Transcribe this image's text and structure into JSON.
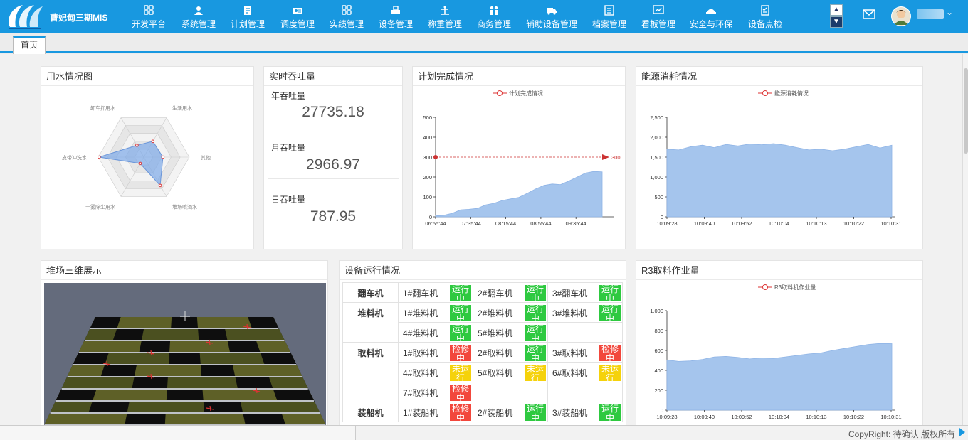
{
  "app": {
    "title": "曹妃甸三期MIS"
  },
  "nav": [
    {
      "label": "开发平台",
      "icon": "grid-icon"
    },
    {
      "label": "系统管理",
      "icon": "user-gear-icon"
    },
    {
      "label": "计划管理",
      "icon": "document-icon"
    },
    {
      "label": "调度管理",
      "icon": "dispatch-icon"
    },
    {
      "label": "实绩管理",
      "icon": "grid-icon"
    },
    {
      "label": "设备管理",
      "icon": "equipment-icon"
    },
    {
      "label": "称重管理",
      "icon": "scale-icon"
    },
    {
      "label": "商务管理",
      "icon": "people-icon"
    },
    {
      "label": "辅助设备管理",
      "icon": "truck-icon"
    },
    {
      "label": "档案管理",
      "icon": "archive-icon"
    },
    {
      "label": "看板管理",
      "icon": "board-icon"
    },
    {
      "label": "安全与环保",
      "icon": "safety-icon"
    },
    {
      "label": "设备点检",
      "icon": "checklist-icon"
    }
  ],
  "header_controls": {
    "up": "▲",
    "down": "▼",
    "caret": "⌄"
  },
  "tabs": [
    {
      "label": "首页",
      "active": true
    }
  ],
  "panels": {
    "water": {
      "title": "用水情况图"
    },
    "throughput": {
      "title": "实时吞吐量",
      "items": [
        {
          "label": "年吞吐量",
          "value": "27735.18"
        },
        {
          "label": "月吞吐量",
          "value": "2966.97"
        },
        {
          "label": "日吞吐量",
          "value": "787.95"
        }
      ]
    },
    "plan": {
      "title": "计划完成情况"
    },
    "energy": {
      "title": "能源消耗情况"
    },
    "yard3d": {
      "title": "堆场三维展示"
    },
    "equipment": {
      "title": "设备运行情况"
    },
    "r3": {
      "title": "R3取料作业量"
    }
  },
  "status_colors": {
    "运行中": "#2ec940",
    "检修中": "#f2473c",
    "未运行": "#f5d20b"
  },
  "equipment_groups": [
    {
      "name": "翻车机",
      "rows": [
        [
          {
            "name": "1#翻车机",
            "status": "运行中"
          },
          {
            "name": "2#翻车机",
            "status": "运行中"
          },
          {
            "name": "3#翻车机",
            "status": "运行中"
          }
        ]
      ]
    },
    {
      "name": "堆料机",
      "rows": [
        [
          {
            "name": "1#堆料机",
            "status": "运行中"
          },
          {
            "name": "2#堆料机",
            "status": "运行中"
          },
          {
            "name": "3#堆料机",
            "status": "运行中"
          }
        ],
        [
          {
            "name": "4#堆料机",
            "status": "运行中"
          },
          {
            "name": "5#堆料机",
            "status": "运行中"
          },
          null
        ]
      ]
    },
    {
      "name": "取料机",
      "rows": [
        [
          {
            "name": "1#取料机",
            "status": "检修中"
          },
          {
            "name": "2#取料机",
            "status": "运行中"
          },
          {
            "name": "3#取料机",
            "status": "检修中"
          }
        ],
        [
          {
            "name": "4#取料机",
            "status": "未运行"
          },
          {
            "name": "5#取料机",
            "status": "未运行"
          },
          {
            "name": "6#取料机",
            "status": "未运行"
          }
        ],
        [
          {
            "name": "7#取料机",
            "status": "检修中"
          },
          null,
          null
        ]
      ]
    },
    {
      "name": "装船机",
      "rows": [
        [
          {
            "name": "1#装船机",
            "status": "检修中"
          },
          {
            "name": "2#装船机",
            "status": "运行中"
          },
          {
            "name": "3#装船机",
            "status": "运行中"
          }
        ]
      ]
    }
  ],
  "chart_data": [
    {
      "type": "radar",
      "id": "water",
      "indicators": [
        "生活用水",
        "其他",
        "堆场喷洒水",
        "干雾除尘用水",
        "皮带冲洗水",
        "卸车抑用水"
      ],
      "values": [
        0.4,
        0.42,
        0.72,
        0.16,
        0.98,
        0.3
      ],
      "color": "#7ea9e8"
    },
    {
      "type": "area",
      "id": "plan",
      "legend": "计划完成情况",
      "x_ticks": [
        "06:55:44",
        "07:35:44",
        "08:15:44",
        "08:55:44",
        "09:35:44"
      ],
      "values": [
        5,
        8,
        18,
        35,
        38,
        42,
        60,
        68,
        82,
        90,
        98,
        118,
        140,
        158,
        165,
        162,
        180,
        200,
        220,
        228,
        226
      ],
      "ylim": [
        0,
        500
      ],
      "y_ticks": [
        0,
        100,
        200,
        300,
        400,
        500
      ],
      "markline": 300,
      "color": "#a5c5ed"
    },
    {
      "type": "area",
      "id": "energy",
      "legend": "能源消耗情况",
      "x_ticks": [
        "10:09:28",
        "10:09:40",
        "10:09:52",
        "10:10:04",
        "10:10:13",
        "10:10:22",
        "10:10:31"
      ],
      "values": [
        1700,
        1680,
        1760,
        1800,
        1740,
        1820,
        1780,
        1830,
        1810,
        1840,
        1800,
        1740,
        1680,
        1700,
        1660,
        1700,
        1760,
        1820,
        1730,
        1800
      ],
      "ylim": [
        0,
        2500
      ],
      "y_ticks": [
        "0",
        "500",
        "1,000",
        "1,500",
        "2,000",
        "2,500"
      ],
      "color": "#a5c5ed"
    },
    {
      "type": "area",
      "id": "r3",
      "legend": "R3取料机作业量",
      "x_ticks": [
        "10:09:28",
        "10:09:40",
        "10:09:52",
        "10:10:04",
        "10:10:13",
        "10:10:22",
        "10:10:31"
      ],
      "values": [
        505,
        490,
        495,
        510,
        535,
        540,
        530,
        515,
        525,
        520,
        535,
        550,
        565,
        575,
        600,
        620,
        640,
        660,
        670,
        668
      ],
      "ylim": [
        0,
        1000
      ],
      "y_ticks": [
        "0",
        "200",
        "400",
        "600",
        "800",
        "1,000"
      ],
      "color": "#a5c5ed"
    }
  ],
  "footer": {
    "copyright": "CopyRight: 待确认    版权所有"
  }
}
